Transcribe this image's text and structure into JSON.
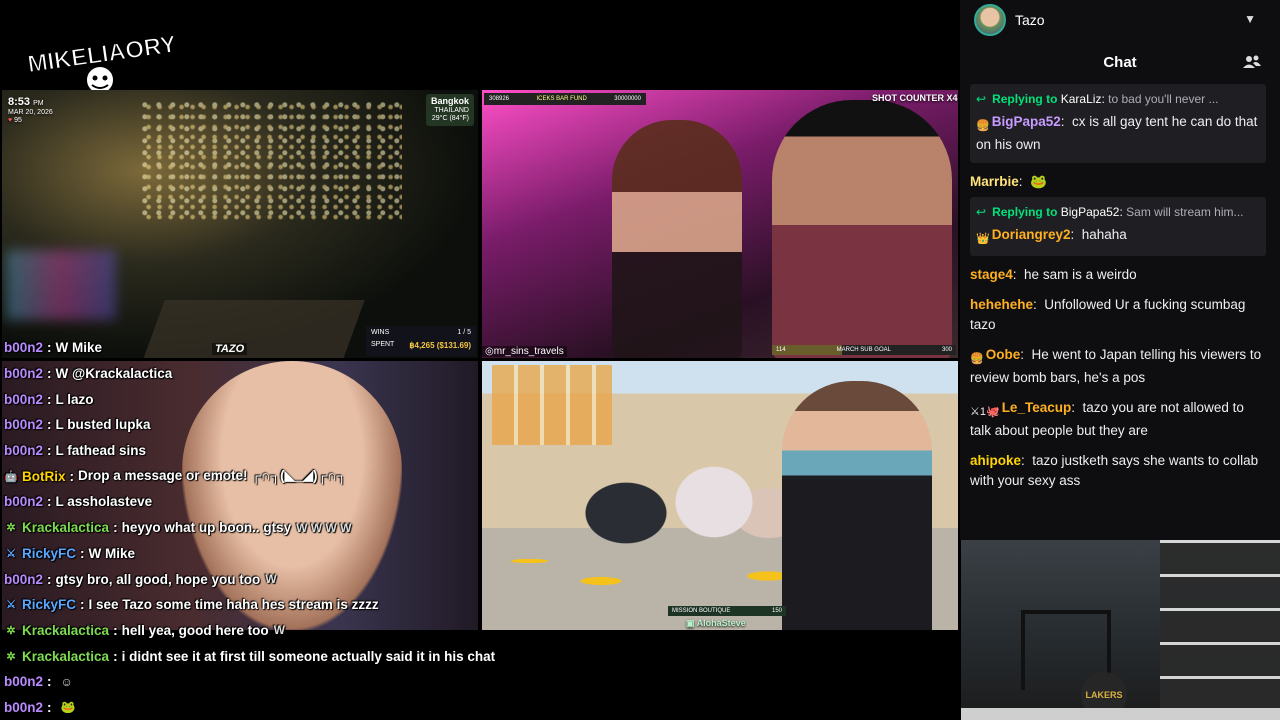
{
  "overlay": {
    "logo_text": "MIKELIAORY",
    "colors": {
      "username": "#b98bff",
      "bot": "#ffd400",
      "mod_green": "#7ddc4f",
      "accent_green": "#00e37a",
      "chat_bg": "#0e0e10"
    },
    "tile1": {
      "time": "8:53",
      "ampm": "PM",
      "date": "MAR 20, 2026",
      "hearts": "95",
      "city": "Bangkok",
      "country": "THAILAND",
      "weather": "29°C (84°F)",
      "brand": "TAZO",
      "wins_label": "WINS",
      "wins_count": "1 / 5",
      "spent_label": "SPENT",
      "spent_amount": "฿4,265 ($131.69)"
    },
    "tile2": {
      "fund_left": "308926",
      "fund_label": "ICEKS BAR FUND",
      "fund_right": "30000000",
      "shot_counter": "SHOT COUNTER  X4",
      "handle": "mr_sins_travels",
      "goal_left": "114",
      "goal_label": "MARCH SUB GOAL",
      "goal_right": "300",
      "goal_progress": 0.38
    },
    "tile4": {
      "mission": "MISSION BOUTIQUE",
      "mission_amt": "150",
      "handle": "AlohaSteve"
    },
    "chat": [
      {
        "icon": "",
        "user": "b00n2",
        "color": "#b98bff",
        "text": "W Mike",
        "emote": ""
      },
      {
        "icon": "",
        "user": "b00n2",
        "color": "#b98bff",
        "text": "W @Krackalactica",
        "emote": ""
      },
      {
        "icon": "",
        "user": "b00n2",
        "color": "#b98bff",
        "text": "L lazo",
        "emote": ""
      },
      {
        "icon": "",
        "user": "b00n2",
        "color": "#b98bff",
        "text": "L busted lupka",
        "emote": ""
      },
      {
        "icon": "",
        "user": "b00n2",
        "color": "#b98bff",
        "text": "L fathead sins",
        "emote": ""
      },
      {
        "icon": "bot-icon",
        "user": "BotRix",
        "color": "#ffd400",
        "text": "Drop a message or emote! ┌∩┐(◣_◢)┌∩┐",
        "emote": ""
      },
      {
        "icon": "",
        "user": "b00n2",
        "color": "#b98bff",
        "text": "L assholasteve",
        "emote": ""
      },
      {
        "icon": "leaf-icon",
        "user": "Krackalactica",
        "color": "#7ddc4f",
        "text": "heyyo what up boon.. gtsy",
        "emote": "W  W  W  W"
      },
      {
        "icon": "sword-icon",
        "user": "RickyFC",
        "color": "#5aa8ff",
        "text": "W Mike",
        "emote": ""
      },
      {
        "icon": "",
        "user": "b00n2",
        "color": "#b98bff",
        "text": "gtsy bro, all good, hope you too",
        "emote": "W"
      },
      {
        "icon": "sword-icon",
        "user": "RickyFC",
        "color": "#5aa8ff",
        "text": "I see Tazo some time haha hes stream is zzzz",
        "emote": ""
      },
      {
        "icon": "leaf-icon",
        "user": "Krackalactica",
        "color": "#7ddc4f",
        "text": "hell yea, good here too",
        "emote": "W"
      },
      {
        "icon": "leaf-icon",
        "user": "Krackalactica",
        "color": "#7ddc4f",
        "text": "i didnt see it at first till someone actually said it in his chat",
        "emote": ""
      },
      {
        "icon": "",
        "user": "b00n2",
        "color": "#b98bff",
        "text": "",
        "emote": "☺"
      },
      {
        "icon": "",
        "user": "b00n2",
        "color": "#b98bff",
        "text": "",
        "emote": "🐸"
      }
    ]
  },
  "twitch": {
    "profile_name": "Tazo",
    "chat_title": "Chat",
    "messages": [
      {
        "type": "reply",
        "reply_label": "Replying to",
        "reply_to": "KaraLiz:",
        "reply_text": "to bad you'll never ...",
        "badge": "🍔",
        "user": "BigPapa52",
        "color": "#c79bff",
        "text": "cx is all gay tent he can do that on his own"
      },
      {
        "type": "msg",
        "user": "Marrbie",
        "color": "#ffe27a",
        "text": "🐸"
      },
      {
        "type": "reply",
        "reply_label": "Replying to",
        "reply_to": "BigPapa52:",
        "reply_text": "Sam will stream him...",
        "badge": "👑",
        "user": "Doriangrey2",
        "color": "#ffb020",
        "text": "hahaha"
      },
      {
        "type": "msg",
        "user": "stage4",
        "color": "#ffb020",
        "text": "he sam is a weirdo"
      },
      {
        "type": "msg",
        "user": "hehehehe",
        "color": "#ffb020",
        "text": "Unfollowed Ur a fucking scumbag tazo"
      },
      {
        "type": "msg",
        "badge": "🍔",
        "user": "Oobe",
        "color": "#ffb020",
        "text": "He went to Japan telling his viewers to review bomb bars, he's a pos"
      },
      {
        "type": "msg",
        "badge": "⚔1🐙",
        "user": "Le_Teacup",
        "color": "#ffb020",
        "text": "tazo you are not allowed to talk about people but they are"
      },
      {
        "type": "msg",
        "user": "ahipoke",
        "color": "#ffd400",
        "text": "tazo justketh says she wants to collab with your sexy ass"
      }
    ]
  },
  "webcam": {
    "logo": "LAKERS"
  }
}
